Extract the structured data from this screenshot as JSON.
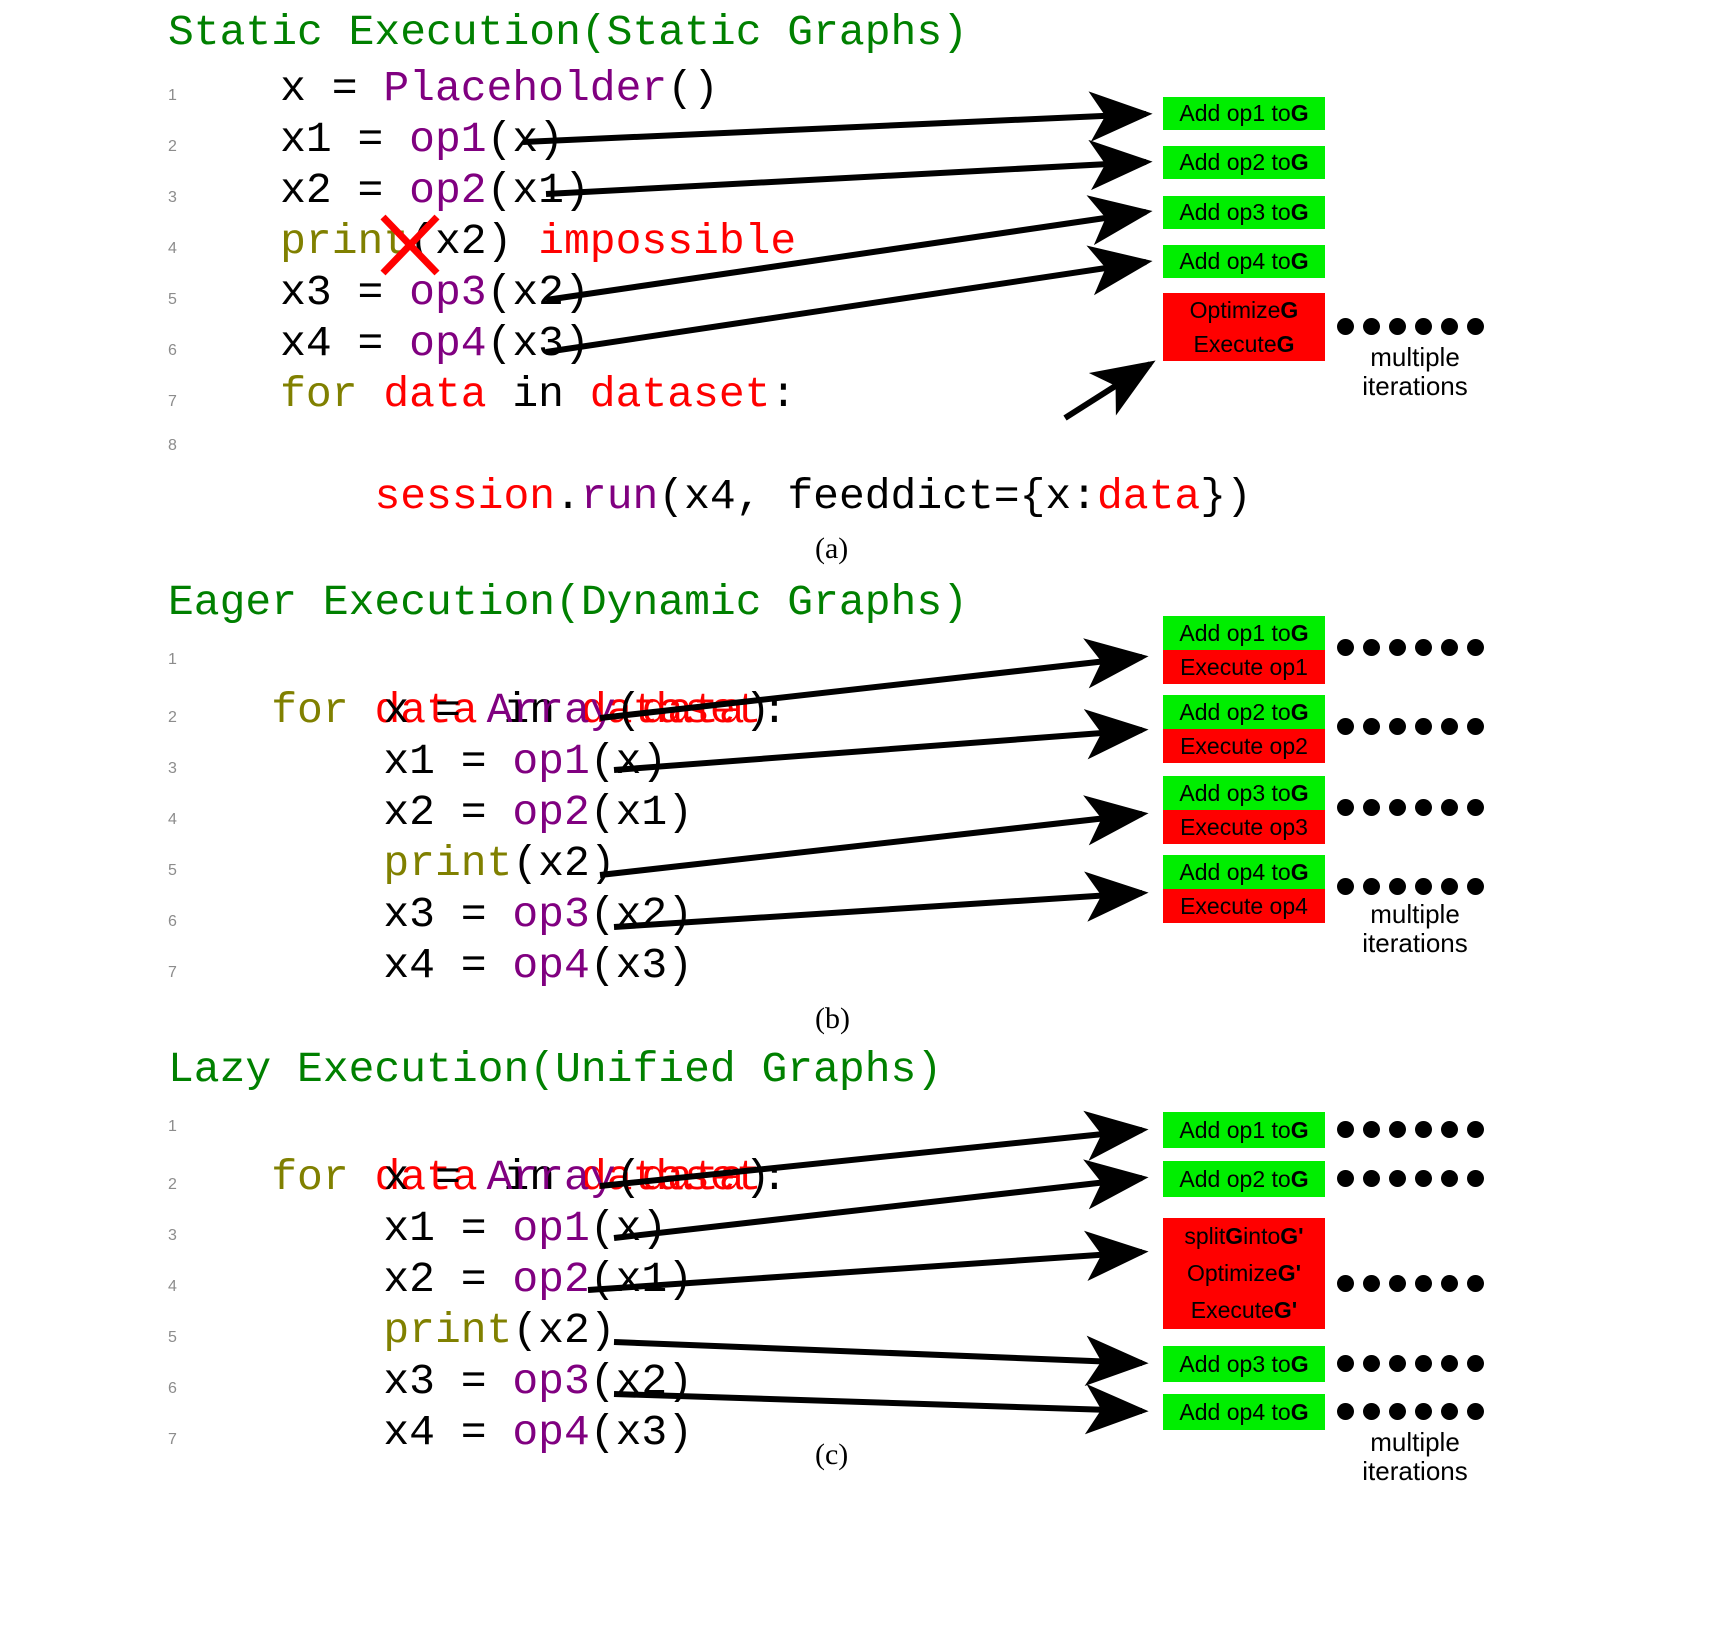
{
  "figure": {
    "panels": [
      {
        "id": "a",
        "title": "Static Execution(Static Graphs)",
        "caption": "(a)",
        "lines": [
          {
            "num": "1",
            "tokens": [
              {
                "t": "    x = ",
                "c": "plain"
              },
              {
                "t": "Placeholder",
                "c": "fn"
              },
              {
                "t": "()",
                "c": "plain"
              }
            ]
          },
          {
            "num": "2",
            "tokens": [
              {
                "t": "    x1 = ",
                "c": "plain"
              },
              {
                "t": "op1",
                "c": "fn"
              },
              {
                "t": "(x)",
                "c": "plain"
              }
            ]
          },
          {
            "num": "3",
            "tokens": [
              {
                "t": "    x2 = ",
                "c": "plain"
              },
              {
                "t": "op2",
                "c": "fn"
              },
              {
                "t": "(x1)",
                "c": "plain"
              }
            ]
          },
          {
            "num": "4",
            "tokens": [
              {
                "t": "    ",
                "c": "plain"
              },
              {
                "t": "print",
                "c": "kw"
              },
              {
                "t": "(x2) ",
                "c": "plain"
              },
              {
                "t": "impossible",
                "c": "str"
              }
            ]
          },
          {
            "num": "5",
            "tokens": [
              {
                "t": "    x3 = ",
                "c": "plain"
              },
              {
                "t": "op3",
                "c": "fn"
              },
              {
                "t": "(x2)",
                "c": "plain"
              }
            ]
          },
          {
            "num": "6",
            "tokens": [
              {
                "t": "    x4 = ",
                "c": "plain"
              },
              {
                "t": "op4",
                "c": "fn"
              },
              {
                "t": "(x3)",
                "c": "plain"
              }
            ]
          },
          {
            "num": "7",
            "tokens": [
              {
                "t": "    ",
                "c": "plain"
              },
              {
                "t": "for",
                "c": "kw"
              },
              {
                "t": " ",
                "c": "plain"
              },
              {
                "t": "data",
                "c": "str"
              },
              {
                "t": " in ",
                "c": "plain"
              },
              {
                "t": "dataset",
                "c": "str"
              },
              {
                "t": ":",
                "c": "plain"
              }
            ]
          },
          {
            "num": "8",
            "tokens": [
              {
                "t": "        ",
                "c": "plain"
              },
              {
                "t": "session",
                "c": "str"
              },
              {
                "t": ".",
                "c": "plain"
              },
              {
                "t": "run",
                "c": "fn"
              },
              {
                "t": "(x4, feeddict={x:",
                "c": "plain"
              },
              {
                "t": "data",
                "c": "str"
              },
              {
                "t": "})",
                "c": "plain"
              }
            ]
          }
        ],
        "strike_on_line": 4,
        "boxes": [
          {
            "kind": "single",
            "color": "green",
            "pre": "Add op1 to ",
            "bold": "G",
            "post": ""
          },
          {
            "kind": "single",
            "color": "green",
            "pre": "Add op2 to ",
            "bold": "G",
            "post": ""
          },
          {
            "kind": "single",
            "color": "green",
            "pre": "Add op3 to ",
            "bold": "G",
            "post": ""
          },
          {
            "kind": "single",
            "color": "green",
            "pre": "Add op4 to ",
            "bold": "G",
            "post": ""
          },
          {
            "kind": "stack",
            "color": "red",
            "segments": [
              {
                "pre": "Optimize ",
                "bold": "G",
                "post": ""
              },
              {
                "pre": "Execute ",
                "bold": "G",
                "post": ""
              }
            ]
          }
        ],
        "dot_groups": 1,
        "dots_per_group": 6,
        "multiple_label": "multiple\niterations"
      },
      {
        "id": "b",
        "title": "Eager Execution(Dynamic Graphs)",
        "caption": "(b)",
        "lines": [
          {
            "num": "1",
            "tokens": [
              {
                "t": "    ",
                "c": "plain"
              },
              {
                "t": "for",
                "c": "kw"
              },
              {
                "t": " ",
                "c": "plain"
              },
              {
                "t": "data",
                "c": "str"
              },
              {
                "t": " in ",
                "c": "plain"
              },
              {
                "t": "dataset",
                "c": "str"
              },
              {
                "t": ":",
                "c": "plain"
              }
            ]
          },
          {
            "num": "2",
            "tokens": [
              {
                "t": "        x = ",
                "c": "plain"
              },
              {
                "t": "Array",
                "c": "fn"
              },
              {
                "t": "(",
                "c": "plain"
              },
              {
                "t": "data",
                "c": "str"
              },
              {
                "t": ")",
                "c": "plain"
              }
            ]
          },
          {
            "num": "3",
            "tokens": [
              {
                "t": "        x1 = ",
                "c": "plain"
              },
              {
                "t": "op1",
                "c": "fn"
              },
              {
                "t": "(x)",
                "c": "plain"
              }
            ]
          },
          {
            "num": "4",
            "tokens": [
              {
                "t": "        x2 = ",
                "c": "plain"
              },
              {
                "t": "op2",
                "c": "fn"
              },
              {
                "t": "(x1)",
                "c": "plain"
              }
            ]
          },
          {
            "num": "5",
            "tokens": [
              {
                "t": "        ",
                "c": "plain"
              },
              {
                "t": "print",
                "c": "kw"
              },
              {
                "t": "(x2)",
                "c": "plain"
              }
            ]
          },
          {
            "num": "6",
            "tokens": [
              {
                "t": "        x3 = ",
                "c": "plain"
              },
              {
                "t": "op3",
                "c": "fn"
              },
              {
                "t": "(x2)",
                "c": "plain"
              }
            ]
          },
          {
            "num": "7",
            "tokens": [
              {
                "t": "        x4 = ",
                "c": "plain"
              },
              {
                "t": "op4",
                "c": "fn"
              },
              {
                "t": "(x3)",
                "c": "plain"
              }
            ]
          }
        ],
        "boxes": [
          {
            "kind": "stack",
            "segments": [
              {
                "color": "green",
                "pre": "Add op1 to ",
                "bold": "G",
                "post": ""
              },
              {
                "color": "red",
                "pre": "Execute op1",
                "bold": "",
                "post": ""
              }
            ]
          },
          {
            "kind": "stack",
            "segments": [
              {
                "color": "green",
                "pre": "Add op2 to ",
                "bold": "G",
                "post": ""
              },
              {
                "color": "red",
                "pre": "Execute op2",
                "bold": "",
                "post": ""
              }
            ]
          },
          {
            "kind": "stack",
            "segments": [
              {
                "color": "green",
                "pre": "Add op3 to ",
                "bold": "G",
                "post": ""
              },
              {
                "color": "red",
                "pre": "Execute op3",
                "bold": "",
                "post": ""
              }
            ]
          },
          {
            "kind": "stack",
            "segments": [
              {
                "color": "green",
                "pre": "Add op4 to ",
                "bold": "G",
                "post": ""
              },
              {
                "color": "red",
                "pre": "Execute op4",
                "bold": "",
                "post": ""
              }
            ]
          }
        ],
        "dot_groups": 4,
        "dots_per_group": 6,
        "multiple_label": "multiple\niterations"
      },
      {
        "id": "c",
        "title": "Lazy Execution(Unified Graphs)",
        "caption": "(c)",
        "lines": [
          {
            "num": "1",
            "tokens": [
              {
                "t": "    ",
                "c": "plain"
              },
              {
                "t": "for",
                "c": "kw"
              },
              {
                "t": " ",
                "c": "plain"
              },
              {
                "t": "data",
                "c": "str"
              },
              {
                "t": " in ",
                "c": "plain"
              },
              {
                "t": "dataset",
                "c": "str"
              },
              {
                "t": ":",
                "c": "plain"
              }
            ]
          },
          {
            "num": "2",
            "tokens": [
              {
                "t": "        x = ",
                "c": "plain"
              },
              {
                "t": "Array",
                "c": "fn"
              },
              {
                "t": "(",
                "c": "plain"
              },
              {
                "t": "data",
                "c": "str"
              },
              {
                "t": ")",
                "c": "plain"
              }
            ]
          },
          {
            "num": "3",
            "tokens": [
              {
                "t": "        x1 = ",
                "c": "plain"
              },
              {
                "t": "op1",
                "c": "fn"
              },
              {
                "t": "(x)",
                "c": "plain"
              }
            ]
          },
          {
            "num": "4",
            "tokens": [
              {
                "t": "        x2 = ",
                "c": "plain"
              },
              {
                "t": "op2",
                "c": "fn"
              },
              {
                "t": "(x1)",
                "c": "plain"
              }
            ]
          },
          {
            "num": "5",
            "tokens": [
              {
                "t": "        ",
                "c": "plain"
              },
              {
                "t": "print",
                "c": "kw"
              },
              {
                "t": "(x2)",
                "c": "plain"
              }
            ]
          },
          {
            "num": "6",
            "tokens": [
              {
                "t": "        x3 = ",
                "c": "plain"
              },
              {
                "t": "op3",
                "c": "fn"
              },
              {
                "t": "(x2)",
                "c": "plain"
              }
            ]
          },
          {
            "num": "7",
            "tokens": [
              {
                "t": "        x4 = ",
                "c": "plain"
              },
              {
                "t": "op4",
                "c": "fn"
              },
              {
                "t": "(x3)",
                "c": "plain"
              }
            ]
          }
        ],
        "boxes": [
          {
            "kind": "single",
            "color": "green",
            "pre": "Add op1 to ",
            "bold": "G",
            "post": ""
          },
          {
            "kind": "single",
            "color": "green",
            "pre": "Add op2 to ",
            "bold": "G",
            "post": ""
          },
          {
            "kind": "stack3",
            "color": "red",
            "segments": [
              {
                "pre": "split ",
                "bold": "G",
                "mid": " into ",
                "bold2": "G'",
                "post": ""
              },
              {
                "pre": "Optimize ",
                "bold": "G'",
                "post": ""
              },
              {
                "pre": "Execute ",
                "bold": "G'",
                "post": ""
              }
            ]
          },
          {
            "kind": "single",
            "color": "green",
            "pre": "Add op3 to ",
            "bold": "G",
            "post": ""
          },
          {
            "kind": "single",
            "color": "green",
            "pre": "Add op4 to ",
            "bold": "G",
            "post": ""
          }
        ],
        "dot_groups": 5,
        "dots_per_group": 6,
        "multiple_label": "multiple\niterations"
      }
    ]
  },
  "colors": {
    "green_box": "#00ee00",
    "red_box": "#ff0000",
    "title_green": "#008000",
    "keyword_olive": "#808000",
    "function_purple": "#800080",
    "string_red": "#ff0000",
    "line_number_gray": "#8c8c8c",
    "arrow_black": "#000000",
    "strike_red": "#ff0000"
  }
}
